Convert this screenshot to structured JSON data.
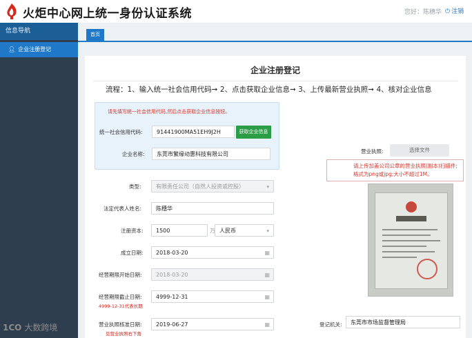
{
  "header": {
    "title": "火炬中心网上统一身份认证系统",
    "greeting": "您好：陈穗华",
    "logout_label": "注销"
  },
  "sidebar": {
    "heading": "信息导航",
    "items": [
      {
        "label": "企业注册登记",
        "icon": "user-icon",
        "active": true
      }
    ]
  },
  "tabs": [
    {
      "label": "首页"
    }
  ],
  "form": {
    "title": "企业注册登记",
    "flow": "流程：1、输入统一社会信用代码➞ 2、点击获取企业信息➞ 3、上传最新营业执照➞ 4、核对企业信息",
    "query": {
      "hint": "请先填写统一社会信用代码,然后点击获取企业信息按钮。",
      "credit_code_label": "统一社会信用代码:",
      "credit_code_value": "91441900MA51EH9J2H",
      "fetch_button": "获取企业信息",
      "company_name_label": "企业名称:",
      "company_name_value": "东莞市繁缘动惠科技有限公司"
    },
    "type_label": "类型:",
    "type_value": "有限责任公司（自然人投资或控股）",
    "legal_rep_label": "法定代表人姓名:",
    "legal_rep_value": "陈穗华",
    "capital_label": "注册资本:",
    "capital_value": "1500",
    "capital_unit": "万",
    "currency_value": "人民币",
    "established_label": "成立日期:",
    "established_value": "2018-03-20",
    "term_start_label": "经营期限开始日期:",
    "term_start_value": "2018-03-20",
    "term_end_label": "经营期限截止日期:",
    "term_end_value": "4999-12-31",
    "term_end_note": "4999-12-31代表长期",
    "approval_label": "营业执照核准日期:",
    "approval_value": "2019-06-27",
    "approval_note": "见营业执照右下角",
    "license_label": "营业执照:",
    "choose_file": "选择文件",
    "upload_hint": "请上传加盖公司公章的营业执照(副本)扫描件;格式为png或jpg;大小不超过1M。",
    "authority_label": "登记机关:",
    "authority_value": "东莞市市场监督管理局"
  },
  "watermark": {
    "logo": "1CO",
    "text": "大数跨境"
  },
  "colors": {
    "primary": "#1f78c8",
    "sidebar": "#2f3e4f",
    "green": "#2a9d46",
    "warning": "#d9342b"
  }
}
